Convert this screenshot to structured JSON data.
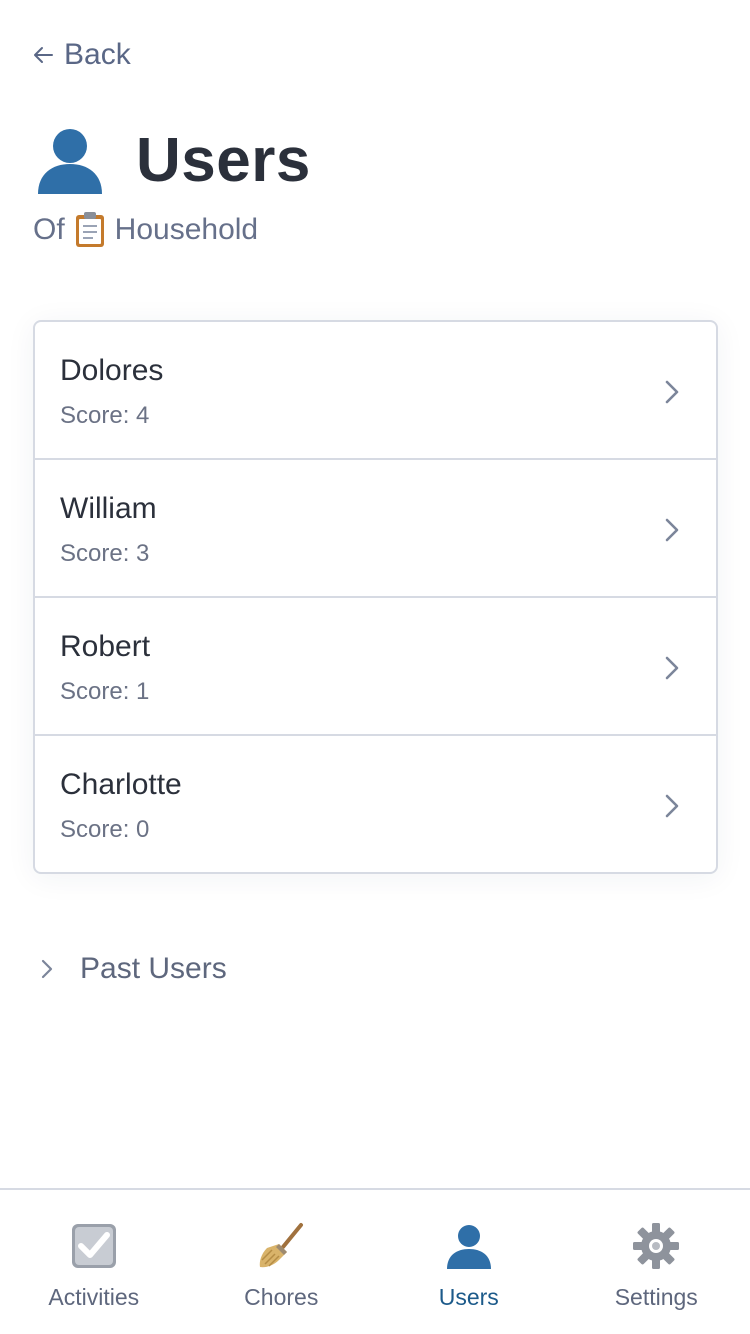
{
  "nav": {
    "back_label": "Back"
  },
  "header": {
    "title": "Users",
    "subtitle_prefix": "Of",
    "subtitle_household": "Household",
    "title_icon": "user-silhouette-icon",
    "subtitle_icon": "clipboard-icon"
  },
  "users": [
    {
      "name": "Dolores",
      "score": "Score: 4"
    },
    {
      "name": "William",
      "score": "Score: 3"
    },
    {
      "name": "Robert",
      "score": "Score: 1"
    },
    {
      "name": "Charlotte",
      "score": "Score: 0"
    }
  ],
  "past_users": {
    "label": "Past Users"
  },
  "tabs": [
    {
      "label": "Activities",
      "icon": "check-box-icon",
      "active": false
    },
    {
      "label": "Chores",
      "icon": "broom-icon",
      "active": false
    },
    {
      "label": "Users",
      "icon": "user-icon",
      "active": true
    },
    {
      "label": "Settings",
      "icon": "gear-icon",
      "active": false
    }
  ],
  "colors": {
    "accent": "#1c5a8a",
    "user_blue": "#2f6fa8",
    "text_dark": "#2b303b",
    "text_muted": "#5e677d",
    "border": "#d6dae3"
  }
}
